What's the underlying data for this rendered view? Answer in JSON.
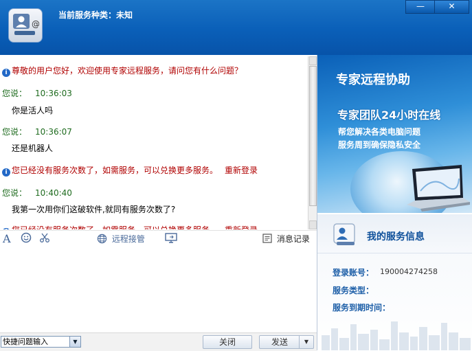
{
  "window": {
    "title": "当前服务种类：未知",
    "minimize_icon": "minimize-icon",
    "close_icon": "close-icon",
    "minimize_glyph": "—",
    "close_glyph": "✕"
  },
  "chat": {
    "system_greeting": "尊敬的用户您好，欢迎使用专家远程服务，请问您有什么问题？",
    "entries": [
      {
        "speaker": "您说：",
        "time": "10:36:03",
        "text": "你是活人吗"
      },
      {
        "speaker": "您说：",
        "time": "10:36:07",
        "text": "还是机器人"
      },
      {
        "speaker": "您说：",
        "time": "10:40:40",
        "text": "我第一次用你们这破软件,就同有服务次数了?"
      }
    ],
    "notice_text": "您已经没有服务次数了，如需服务，可以兑换更多服务。",
    "relogin_label": "重新登录"
  },
  "toolbar": {
    "font_glyph": "A",
    "remote_label": "远程接管",
    "history_label": "消息记录"
  },
  "bottom": {
    "quick_input": "快捷问题输入",
    "close_label": "关闭",
    "send_label": "发送"
  },
  "banner": {
    "title": "专家远程协助",
    "subtitle": "专家团队24小时在线",
    "line1": "帮您解决各类电脑问题",
    "line2": "服务周到确保隐私安全"
  },
  "service_info": {
    "title": "我的服务信息",
    "account_label": "登录账号：",
    "account_value": "190004274258",
    "type_label": "服务类型：",
    "expiry_label": "服务到期时间："
  }
}
